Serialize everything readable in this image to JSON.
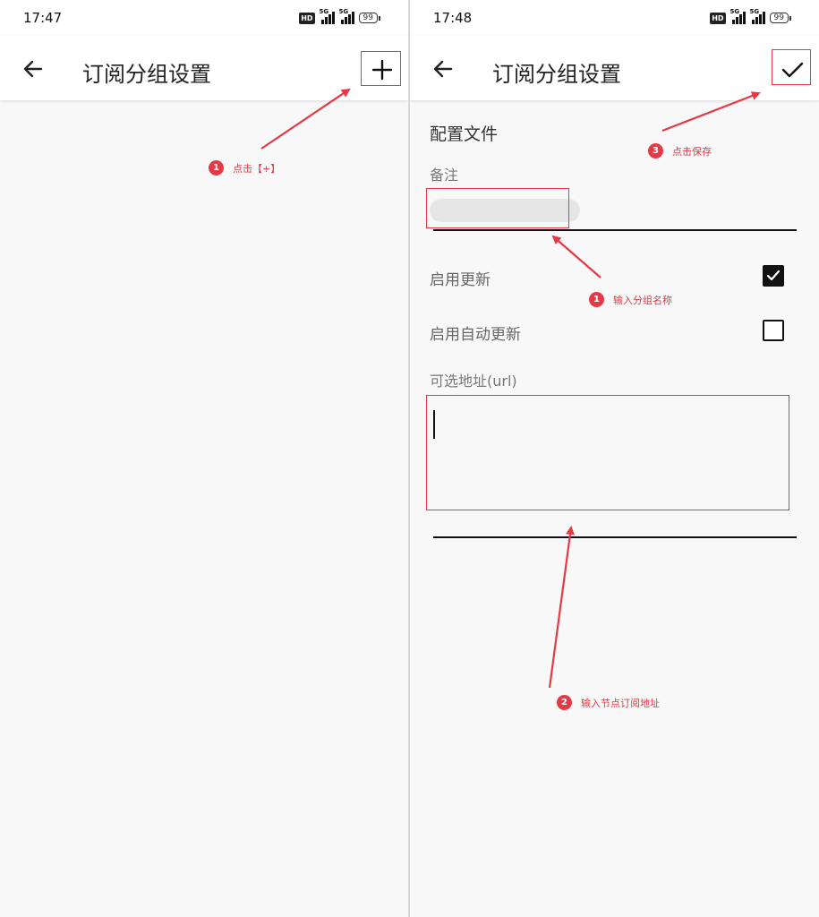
{
  "left_screen": {
    "status": {
      "time": "17:47",
      "hd": "HD",
      "net1": "5G",
      "net2": "5G",
      "battery": "99"
    },
    "title": "订阅分组设置",
    "action_icon": "plus-icon"
  },
  "right_screen": {
    "status": {
      "time": "17:48",
      "hd": "HD",
      "net1": "5G",
      "net2": "5G",
      "battery": "99"
    },
    "title": "订阅分组设置",
    "action_icon": "check-icon",
    "section_title": "配置文件",
    "remark_label": "备注",
    "remark_value": "",
    "enable_update_label": "启用更新",
    "enable_update_checked": true,
    "auto_update_label": "启用自动更新",
    "auto_update_checked": false,
    "url_label": "可选地址(url)",
    "url_value": ""
  },
  "annotations": {
    "left_step1": {
      "num": "1",
      "text": "点击【+】"
    },
    "right_step1": {
      "num": "1",
      "text": "输入分组名称"
    },
    "right_step2": {
      "num": "2",
      "text": "输入节点订阅地址"
    },
    "right_step3": {
      "num": "3",
      "text": "点击保存"
    }
  },
  "colors": {
    "annotation": "#e53946",
    "background": "#f8f8f8"
  }
}
